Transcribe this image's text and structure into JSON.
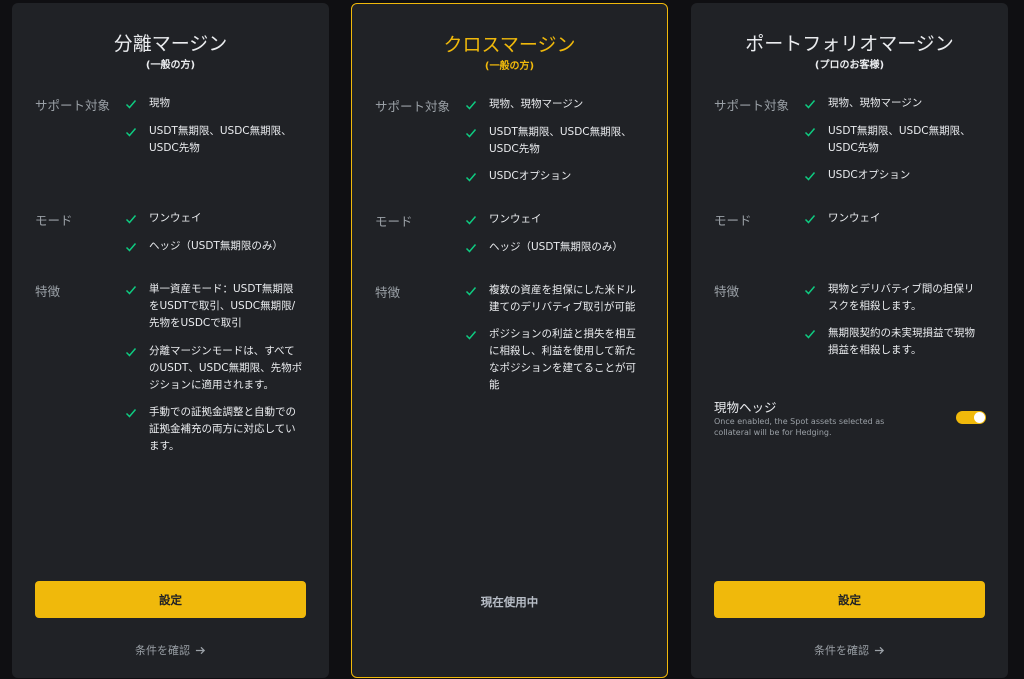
{
  "cards": [
    {
      "title": "分離マージン",
      "subtitle": "(一般の方)",
      "sections": {
        "support": "サポート対象",
        "mode": "モード",
        "features": "特徴"
      },
      "support_items": [
        "現物",
        "USDT無期限、USDC無期限、\nUSDC先物"
      ],
      "mode_items": [
        "ワンウェイ",
        "ヘッジ（USDT無期限のみ）"
      ],
      "feature_items": [
        "単一資産モード：USDT無期限\nをUSDTで取引、USDC無期限/\n先物をUSDCで取引",
        "分離マージンモードは、すべて\nのUSDT、USDC無期限、先物ポ\nジションに適用されます。",
        "手動での証拠金調整と自動での\n証拠金補充の両方に対応してい\nます。"
      ],
      "button": "設定",
      "confirm": "条件を確認"
    },
    {
      "title": "クロスマージン",
      "subtitle": "(一般の方)",
      "sections": {
        "support": "サポート対象",
        "mode": "モード",
        "features": "特徴"
      },
      "support_items": [
        "現物、現物マージン",
        "USDT無期限、USDC無期限、\nUSDC先物",
        "USDCオプション"
      ],
      "mode_items": [
        "ワンウェイ",
        "ヘッジ（USDT無期限のみ）"
      ],
      "feature_items": [
        "複数の資産を担保にした米ドル\n建てのデリバティブ取引が可能",
        "ポジションの利益と損失を相互\nに相殺し、利益を使用して新た\nなポジションを建てることが可\n能"
      ],
      "status": "現在使用中"
    },
    {
      "title": "ポートフォリオマージン",
      "subtitle": "(プロのお客様)",
      "sections": {
        "support": "サポート対象",
        "mode": "モード",
        "features": "特徴"
      },
      "support_items": [
        "現物、現物マージン",
        "USDT無期限、USDC無期限、\nUSDC先物",
        "USDCオプション"
      ],
      "mode_items": [
        "ワンウェイ"
      ],
      "feature_items": [
        "現物とデリバティブ間の担保リ\nスクを相殺します。",
        "無期限契約の未実現損益で現物\n損益を相殺します。"
      ],
      "spot_hedge": {
        "title": "現物ヘッジ",
        "description": "Once enabled, the Spot assets selected as collateral will be for Hedging.",
        "enabled": true
      },
      "button": "設定",
      "confirm": "条件を確認"
    }
  ],
  "colors": {
    "accent": "#f0b90b",
    "check": "#0ecb81",
    "card_bg": "#202226",
    "page_bg": "#0f0f12"
  },
  "icons": {
    "check": "check-icon",
    "arrow": "arrow-right-icon"
  }
}
